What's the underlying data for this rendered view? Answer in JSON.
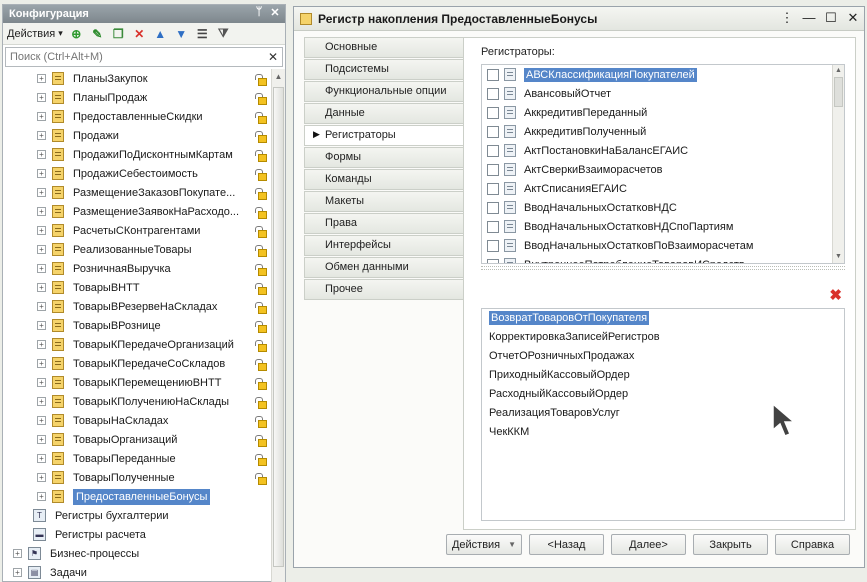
{
  "config_panel": {
    "title": "Конфигурация",
    "pin_icon": "pin-icon",
    "close_icon": "close-icon",
    "toolbar": {
      "actions_label": "Действия",
      "actions_arrow": "▾"
    },
    "search": {
      "placeholder": "Поиск (Ctrl+Alt+M)",
      "clear_glyph": "✕"
    },
    "tree_items": [
      {
        "label": "ПланыЗакупок",
        "locked": true
      },
      {
        "label": "ПланыПродаж",
        "locked": true
      },
      {
        "label": "ПредоставленныеСкидки",
        "locked": true
      },
      {
        "label": "Продажи",
        "locked": true
      },
      {
        "label": "ПродажиПоДисконтнымКартам",
        "locked": true
      },
      {
        "label": "ПродажиСебестоимость",
        "locked": true
      },
      {
        "label": "РазмещениеЗаказовПокупате...",
        "locked": true
      },
      {
        "label": "РазмещениеЗаявокНаРасходо...",
        "locked": true
      },
      {
        "label": "РасчетыСКонтрагентами",
        "locked": true
      },
      {
        "label": "РеализованныеТовары",
        "locked": true
      },
      {
        "label": "РозничнаяВыручка",
        "locked": true
      },
      {
        "label": "ТоварыВНТТ",
        "locked": true
      },
      {
        "label": "ТоварыВРезервеНаСкладах",
        "locked": true
      },
      {
        "label": "ТоварыВРознице",
        "locked": true
      },
      {
        "label": "ТоварыКПередачеОрганизаций",
        "locked": true
      },
      {
        "label": "ТоварыКПередачеСоСкладов",
        "locked": true
      },
      {
        "label": "ТоварыКПеремещениюВНТТ",
        "locked": true
      },
      {
        "label": "ТоварыКПолучениюНаСклады",
        "locked": true
      },
      {
        "label": "ТоварыНаСкладах",
        "locked": true
      },
      {
        "label": "ТоварыОрганизаций",
        "locked": true
      },
      {
        "label": "ТоварыПереданные",
        "locked": true
      },
      {
        "label": "ТоварыПолученные",
        "locked": true
      },
      {
        "label": "ПредоставленныеБонусы",
        "locked": false,
        "selected": true
      }
    ],
    "sections": [
      {
        "label": "Регистры бухгалтерии",
        "icon": "accounting-register-icon"
      },
      {
        "label": "Регистры расчета",
        "icon": "calculation-register-icon"
      }
    ],
    "root_items": [
      {
        "label": "Бизнес-процессы",
        "icon": "business-process-icon"
      },
      {
        "label": "Задачи",
        "icon": "task-icon"
      }
    ]
  },
  "main_window": {
    "title": "Регистр накопления ПредоставленныеБонусы",
    "tabs": [
      {
        "label": "Основные"
      },
      {
        "label": "Подсистемы"
      },
      {
        "label": "Функциональные опции"
      },
      {
        "label": "Данные"
      },
      {
        "label": "Регистраторы",
        "active": true
      },
      {
        "label": "Формы"
      },
      {
        "label": "Команды"
      },
      {
        "label": "Макеты"
      },
      {
        "label": "Права"
      },
      {
        "label": "Интерфейсы"
      },
      {
        "label": "Обмен данными"
      },
      {
        "label": "Прочее"
      }
    ],
    "registrators_label": "Регистраторы:",
    "registrators": [
      {
        "label": "АВСКлассификацияПокупателей",
        "selected": true
      },
      {
        "label": "АвансовыйОтчет"
      },
      {
        "label": "АккредитивПереданный"
      },
      {
        "label": "АккредитивПолученный"
      },
      {
        "label": "АктПостановкиНаБалансЕГАИС"
      },
      {
        "label": "АктСверкиВзаиморасчетов"
      },
      {
        "label": "АктСписанияЕГАИС"
      },
      {
        "label": "ВводНачальныхОстатковНДС"
      },
      {
        "label": "ВводНачальныхОстатковНДСпоПартиям"
      },
      {
        "label": "ВводНачальныхОстатковПоВзаиморасчетам"
      },
      {
        "label": "ВнутреннееПотреблениеТоваровИСредств"
      }
    ],
    "selected_docs": [
      {
        "label": "ВозвратТоваровОтПокупателя",
        "selected": true
      },
      {
        "label": "КорректировкаЗаписейРегистров"
      },
      {
        "label": "ОтчетОРозничныхПродажах"
      },
      {
        "label": "ПриходныйКассовыйОрдер"
      },
      {
        "label": "РасходныйКассовыйОрдер"
      },
      {
        "label": "РеализацияТоваровУслуг"
      },
      {
        "label": "ЧекККМ"
      }
    ],
    "buttons": {
      "actions": "Действия",
      "back": "<Назад",
      "next": "Далее>",
      "close": "Закрыть",
      "help": "Справка"
    }
  },
  "colors": {
    "selection": "#5586c9",
    "delete_red": "#d9312b",
    "panel_header": "#8a9399"
  }
}
